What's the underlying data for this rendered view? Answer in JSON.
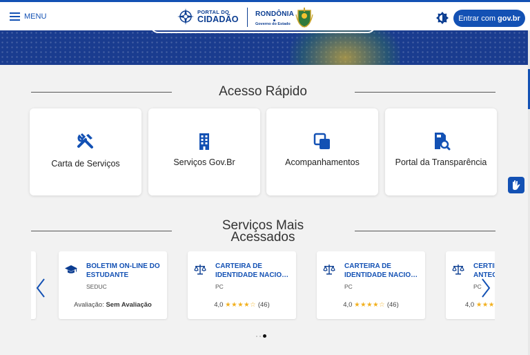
{
  "header": {
    "menu_label": "MENU",
    "logo_portal_line1": "PORTAL DO",
    "logo_portal_line2": "CIDADÃO",
    "logo_state_name": "RONDÔNIA",
    "logo_state_sub": "Governo do Estado",
    "login_prefix": "Entrar com",
    "login_brand": "gov.br"
  },
  "quick_access": {
    "title": "Acesso Rápido",
    "cards": [
      {
        "label": "Carta de Serviços",
        "icon": "tools-icon"
      },
      {
        "label": "Serviços Gov.Br",
        "icon": "building-icon"
      },
      {
        "label": "Acompanhamentos",
        "icon": "copy-icon"
      },
      {
        "label": "Portal da Transparência",
        "icon": "search-document-icon"
      }
    ]
  },
  "most_accessed": {
    "title_line1": "Serviços Mais",
    "title_line2": "Acessados",
    "services": [
      {
        "title_line1": "BOLETIM ON-LINE DO",
        "title_line2": "ESTUDANTE",
        "org": "SEDUC",
        "rating_label": "Avaliação:",
        "rating_value": "Sem Avaliação",
        "icon": "graduation-cap-icon"
      },
      {
        "title_line1": "CARTEIRA DE",
        "title_line2": "IDENTIDADE NACIONA...",
        "org": "PC",
        "rating_score": "4,0",
        "stars": "★★★★☆",
        "reviews": "(46)",
        "icon": "scale-icon"
      },
      {
        "title_line1": "CARTEIRA DE",
        "title_line2": "IDENTIDADE NACIONA...",
        "org": "PC",
        "rating_score": "4,0",
        "stars": "★★★★☆",
        "reviews": "(46)",
        "icon": "scale-icon"
      },
      {
        "title_line1": "CERTID",
        "title_line2": "ANTECI",
        "org": "PC",
        "rating_score": "4,0",
        "stars": "★★★",
        "reviews": "",
        "icon": "scale-icon"
      }
    ]
  },
  "colors": {
    "primary": "#1351b4",
    "star": "#f2b01e",
    "background": "#f2f2f2"
  }
}
